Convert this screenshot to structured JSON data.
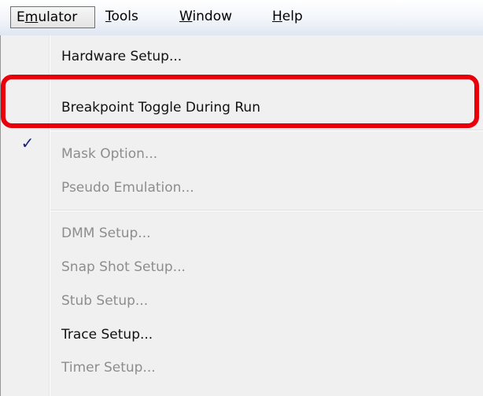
{
  "menubar": {
    "items": [
      {
        "pre": "E",
        "key": "m",
        "post": "ulator",
        "open": true
      },
      {
        "pre": "",
        "key": "T",
        "post": "ools",
        "open": false
      },
      {
        "pre": "",
        "key": "W",
        "post": "indow",
        "open": false
      },
      {
        "pre": "",
        "key": "H",
        "post": "elp",
        "open": false
      }
    ]
  },
  "menu": {
    "items": [
      {
        "label": "Hardware Setup...",
        "enabled": true,
        "checked": false
      },
      {
        "label": "Breakpoint Toggle During Run",
        "enabled": true,
        "checked": true
      },
      {
        "label": "Mask Option...",
        "enabled": false,
        "checked": false
      },
      {
        "label": "Pseudo Emulation...",
        "enabled": false,
        "checked": false
      },
      {
        "label": "DMM Setup...",
        "enabled": false,
        "checked": false
      },
      {
        "label": "Snap Shot Setup...",
        "enabled": false,
        "checked": false
      },
      {
        "label": "Stub Setup...",
        "enabled": false,
        "checked": false
      },
      {
        "label": "Trace Setup...",
        "enabled": true,
        "checked": false
      },
      {
        "label": "Timer Setup...",
        "enabled": false,
        "checked": false
      }
    ],
    "check_glyph": "✓"
  },
  "colors": {
    "highlight_box": "#e8000b",
    "check": "#1a237e",
    "disabled_text": "#8d8d8d"
  }
}
